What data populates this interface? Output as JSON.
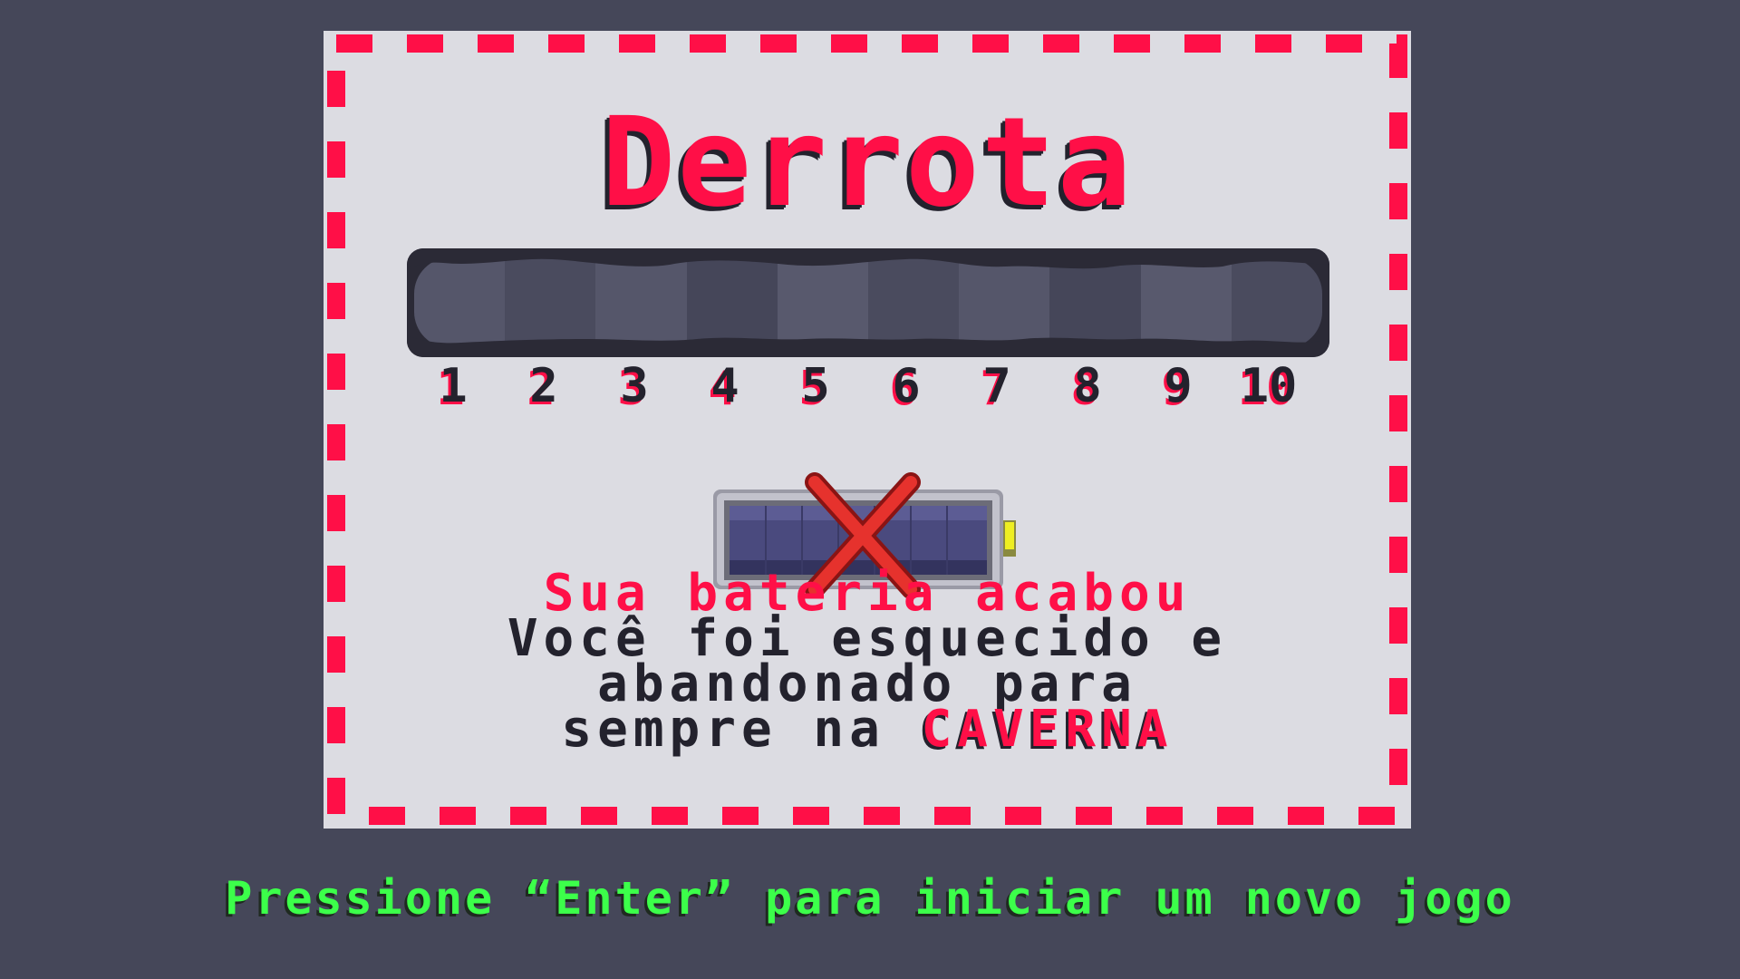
{
  "screen": {
    "title": "Derrota",
    "levels": [
      "1",
      "2",
      "3",
      "4",
      "5",
      "6",
      "7",
      "8",
      "9",
      "10"
    ],
    "battery": {
      "charge_fraction": 0,
      "status_icon": "red-x-icon"
    },
    "message": {
      "headline": "Sua bateria acabou",
      "line1": "Você foi esquecido e",
      "line2": "abandonado para",
      "line3_prefix": "sempre na ",
      "line3_highlight": "CAVERNA"
    },
    "prompt": "Pressione “Enter” para iniciar um novo jogo"
  },
  "colors": {
    "background": "#454759",
    "panel": "#dcdce2",
    "accent_red": "#ff0f47",
    "dark": "#23222d",
    "prompt_green": "#3cff4a",
    "battery_cells": "#4a4a7e"
  }
}
